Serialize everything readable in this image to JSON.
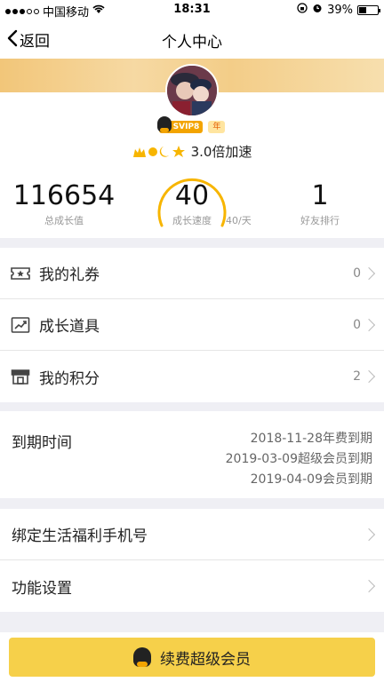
{
  "status_bar": {
    "carrier": "中国移动",
    "time": "18:31",
    "battery": "39%",
    "battery_level": 0.39
  },
  "nav": {
    "back_label": "返回",
    "title": "个人中心"
  },
  "profile": {
    "svip_badge": "SVIP8",
    "year_badge": "年",
    "speed_text": "3.0倍加速"
  },
  "stats": {
    "total_value": "116654",
    "total_label": "总成长值",
    "speed_value": "40",
    "speed_label": "成长速度",
    "speed_rate": "40/天",
    "rank_value": "1",
    "rank_label": "好友排行"
  },
  "menu": {
    "items": [
      {
        "label": "我的礼券",
        "count": "0",
        "icon": "ticket-icon"
      },
      {
        "label": "成长道具",
        "count": "0",
        "icon": "growth-chart-icon"
      },
      {
        "label": "我的积分",
        "count": "2",
        "icon": "store-icon"
      }
    ]
  },
  "expiry": {
    "label": "到期时间",
    "lines": [
      "2018-11-28年费到期",
      "2019-03-09超级会员到期",
      "2019-04-09会员到期"
    ]
  },
  "settings": {
    "items": [
      {
        "label": "绑定生活福利手机号"
      },
      {
        "label": "功能设置"
      }
    ]
  },
  "footer": {
    "renew_label": "续费超级会员"
  },
  "colors": {
    "accent": "#f6d04a",
    "gauge": "#f7b500"
  }
}
